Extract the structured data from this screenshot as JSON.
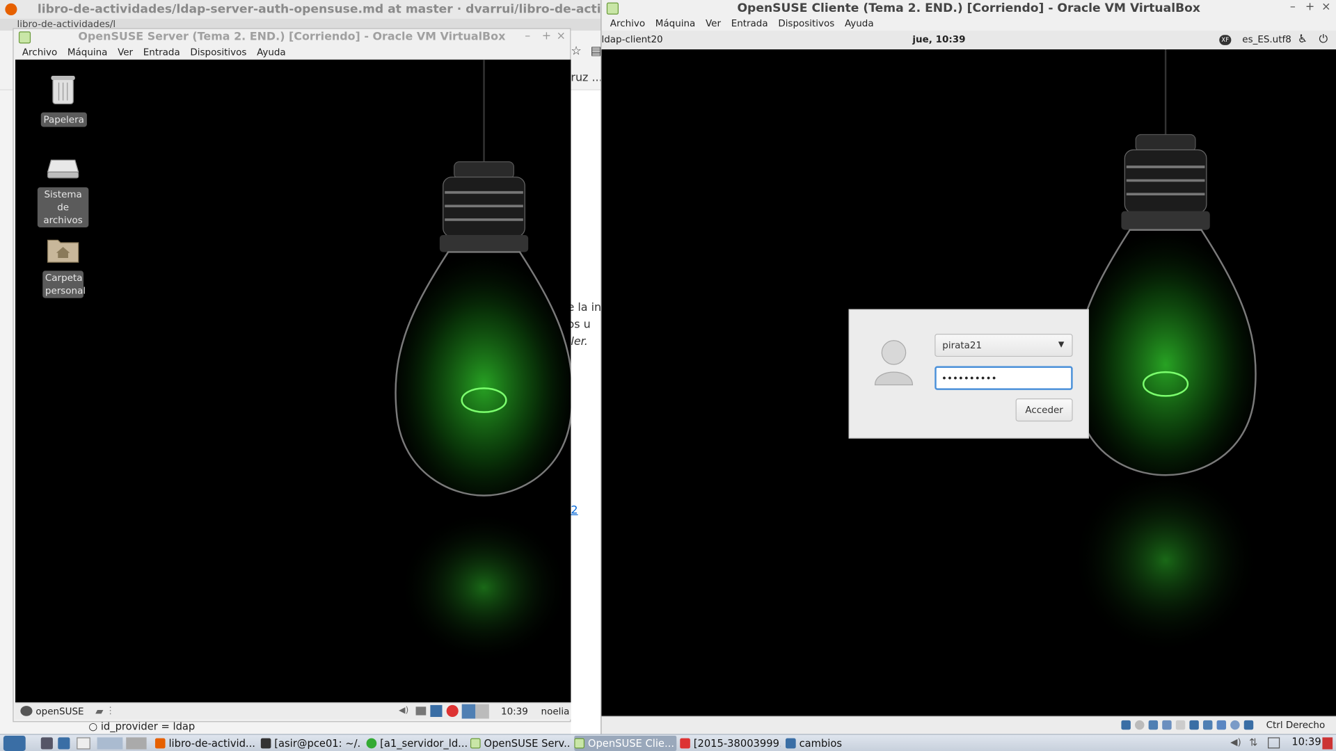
{
  "browser": {
    "title": "libro-de-actividades/ldap-server-auth-opensuse.md at master · dvarrui/libro-de-actividades - Mo",
    "tab_label": "libro-de-actividades/l",
    "fragments": {
      "f1": "ruz ...",
      "f2": "e la in",
      "f3": "n los u",
      "f4": "ler.",
      "f5": "2"
    },
    "code_line": "id_provider =  ldap"
  },
  "server": {
    "title": "OpenSUSE Server (Tema 2. END.) [Corriendo] - Oracle VM VirtualBox",
    "menu": [
      "Archivo",
      "Máquina",
      "Ver",
      "Entrada",
      "Dispositivos",
      "Ayuda"
    ],
    "desktop_icons": {
      "trash": "Papelera",
      "filesystem": "Sistema de archivos",
      "home": "Carpeta personal"
    },
    "panel": {
      "start": "openSUSE",
      "clock": "10:39",
      "user": "noelia"
    }
  },
  "client": {
    "title": "OpenSUSE Cliente (Tema 2. END.) [Corriendo] - Oracle VM VirtualBox",
    "menu": [
      "Archivo",
      "Máquina",
      "Ver",
      "Entrada",
      "Dispositivos",
      "Ayuda"
    ],
    "gnome_bar": {
      "hostname": "ldap-client20",
      "clock": "jue, 10:39",
      "keyboard_badge": "XF",
      "locale": "es_ES.utf8"
    },
    "login": {
      "username": "pirata21",
      "password_mask": "••••••••••",
      "button": "Acceder"
    },
    "host_key": "Ctrl Derecho"
  },
  "taskbar": {
    "items": [
      "libro-de-activid...",
      "[asir@pce01: ~/...",
      "[a1_servidor_ld...",
      "OpenSUSE Serv...",
      "OpenSUSE Clie...",
      "[2015-38003999...",
      "cambios"
    ],
    "clock": "10:39"
  },
  "colors": {
    "bulb_green": "#2fbf2a",
    "focus_blue": "#4a90d9",
    "desktop_bg": "#000000"
  }
}
